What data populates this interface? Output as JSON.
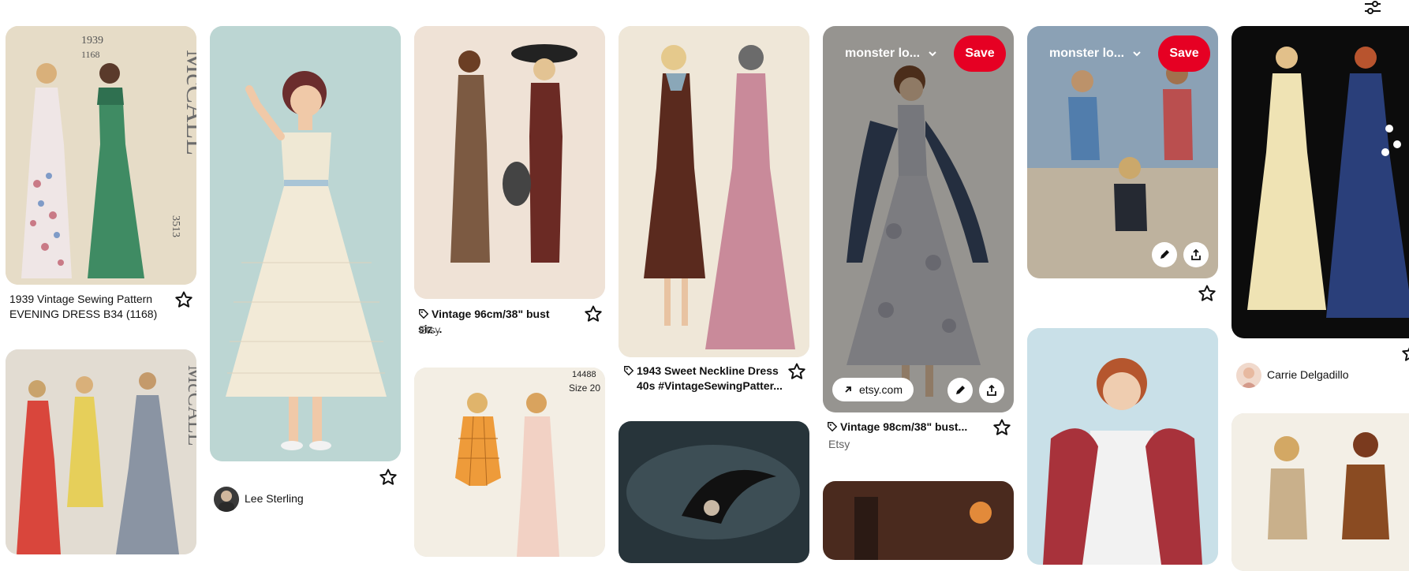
{
  "toolbar": {
    "filter_icon": "sliders-icon"
  },
  "pins": [
    {
      "caption_line1": "1939 Vintage Sewing Pattern",
      "caption_line2": "EVENING DRESS B34 (1168)"
    },
    {
      "author": "Lee Sterling"
    },
    {
      "caption": "Vintage 96cm/38\" bust siz...",
      "source": "Etsy"
    },
    {
      "caption_line1": "1943 Sweet Neckline Dress",
      "caption_line2": "40s #VintageSewingPatter..."
    },
    {
      "board_name": "monster lo...",
      "save_label": "Save",
      "link_label": "etsy.com",
      "caption": "Vintage 98cm/38\" bust...",
      "source": "Etsy"
    },
    {
      "board_name": "monster lo...",
      "save_label": "Save"
    },
    {
      "author": "Carrie Delgadillo"
    }
  ],
  "image_pattern_texts": {
    "pin1_mccall": "McCALL",
    "pin1_year": "1939",
    "pin1_num": "1168",
    "pin1_side": "3513",
    "pin7_mccall": "McCALL",
    "pin8_size": "Size 20",
    "pin8_num": "14488"
  },
  "colors": {
    "save_red": "#e60023",
    "text": "#111111",
    "muted": "#5f5f5f"
  }
}
